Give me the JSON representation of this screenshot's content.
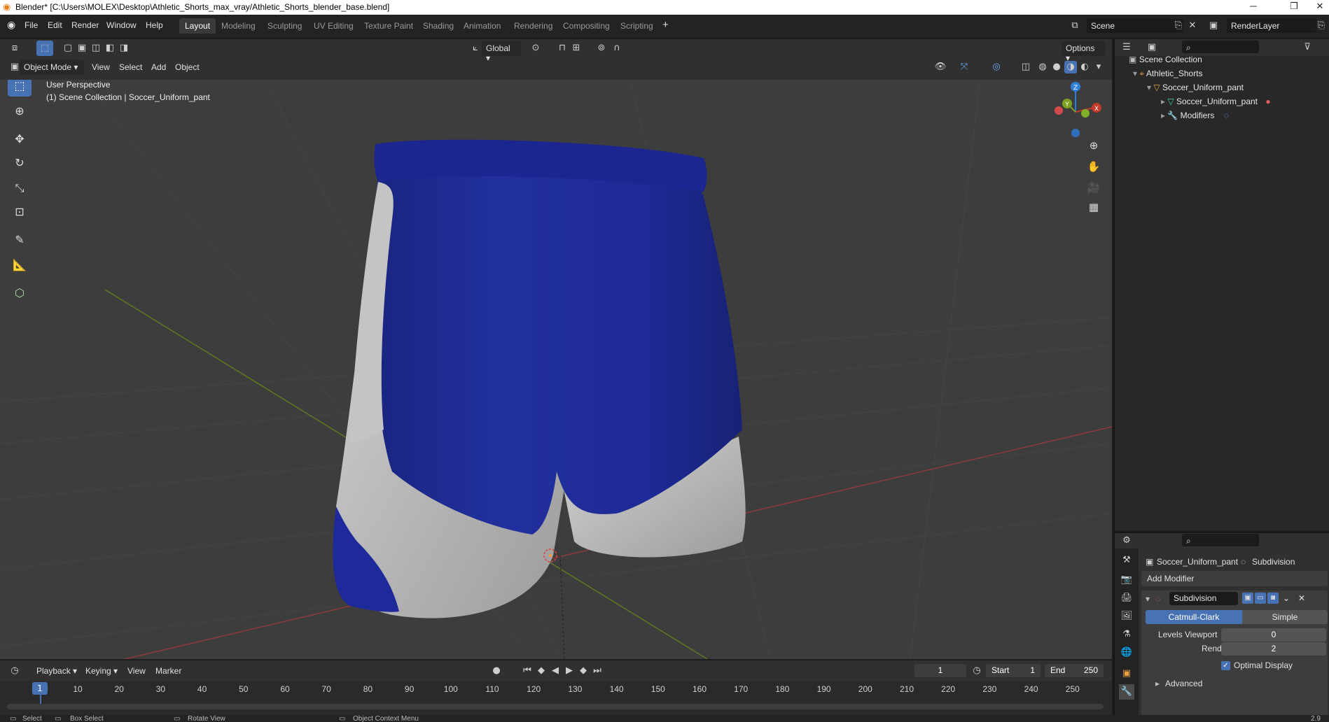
{
  "window": {
    "title": "Blender* [C:\\Users\\MOLEX\\Desktop\\Athletic_Shorts_max_vray/Athletic_Shorts_blender_base.blend]",
    "minimize": "─",
    "maximize": "❐",
    "close": "✕"
  },
  "menu": {
    "items": [
      "File",
      "Edit",
      "Render",
      "Window",
      "Help"
    ]
  },
  "workspaces": {
    "tabs": [
      "Layout",
      "Modeling",
      "Sculpting",
      "UV Editing",
      "Texture Paint",
      "Shading",
      "Animation",
      "Rendering",
      "Compositing",
      "Scripting"
    ],
    "active": "Layout",
    "add": "+"
  },
  "scene": {
    "name": "Scene",
    "render_layer": "RenderLayer"
  },
  "viewport_header": {
    "mode": "Object Mode",
    "menus": [
      "View",
      "Select",
      "Add",
      "Object"
    ],
    "orientation": "Global",
    "options": "Options"
  },
  "viewport": {
    "info_line1": "User Perspective",
    "info_line2": "(1) Scene Collection | Soccer_Uniform_pant",
    "gizmo": {
      "x": "X",
      "y": "Y",
      "z": "Z"
    }
  },
  "outliner": {
    "root": "Scene Collection",
    "collection": "Athletic_Shorts",
    "object": "Soccer_Uniform_pant",
    "mesh": "Soccer_Uniform_pant",
    "modifiers": "Modifiers"
  },
  "properties": {
    "object_name": "Soccer_Uniform_pant",
    "modifier_crumb": "Subdivision",
    "add_modifier": "Add Modifier",
    "modifier_name": "Subdivision",
    "mode_catmull": "Catmull-Clark",
    "mode_simple": "Simple",
    "levels_viewport_label": "Levels Viewport",
    "levels_viewport_value": "0",
    "render_label": "Render",
    "render_value": "2",
    "optimal_display": "Optimal Display",
    "advanced": "Advanced"
  },
  "timeline": {
    "menus": [
      "Playback",
      "Keying",
      "View",
      "Marker"
    ],
    "current_frame": "1",
    "start_label": "Start",
    "start_value": "1",
    "end_label": "End",
    "end_value": "250",
    "ruler": [
      "10",
      "20",
      "30",
      "40",
      "50",
      "60",
      "70",
      "80",
      "90",
      "100",
      "110",
      "120",
      "130",
      "140",
      "150",
      "160",
      "170",
      "180",
      "190",
      "200",
      "210",
      "220",
      "230",
      "240",
      "250"
    ],
    "playhead": "1"
  },
  "statusbar": {
    "select": "Select",
    "box_select": "Box Select",
    "rotate_view": "Rotate View",
    "context_menu": "Object Context Menu",
    "version": "2.9"
  },
  "colors": {
    "accent": "#4772b3",
    "shorts_blue": "#1e2a9c",
    "shorts_white": "#c8c8c8",
    "viewport_bg": "#3d3d3d",
    "x_axis": "#c0392b",
    "y_axis": "#7ca020",
    "z_axis": "#2e7fd8"
  },
  "icons": {
    "blender_logo": "blender-logo-icon",
    "select_box": "select-box-icon",
    "cursor": "cursor-icon",
    "move": "move-icon",
    "rotate": "rotate-icon",
    "scale": "scale-icon",
    "transform": "transform-icon",
    "annotate": "annotate-icon",
    "measure": "measure-icon",
    "add_cube": "add-cube-icon"
  }
}
